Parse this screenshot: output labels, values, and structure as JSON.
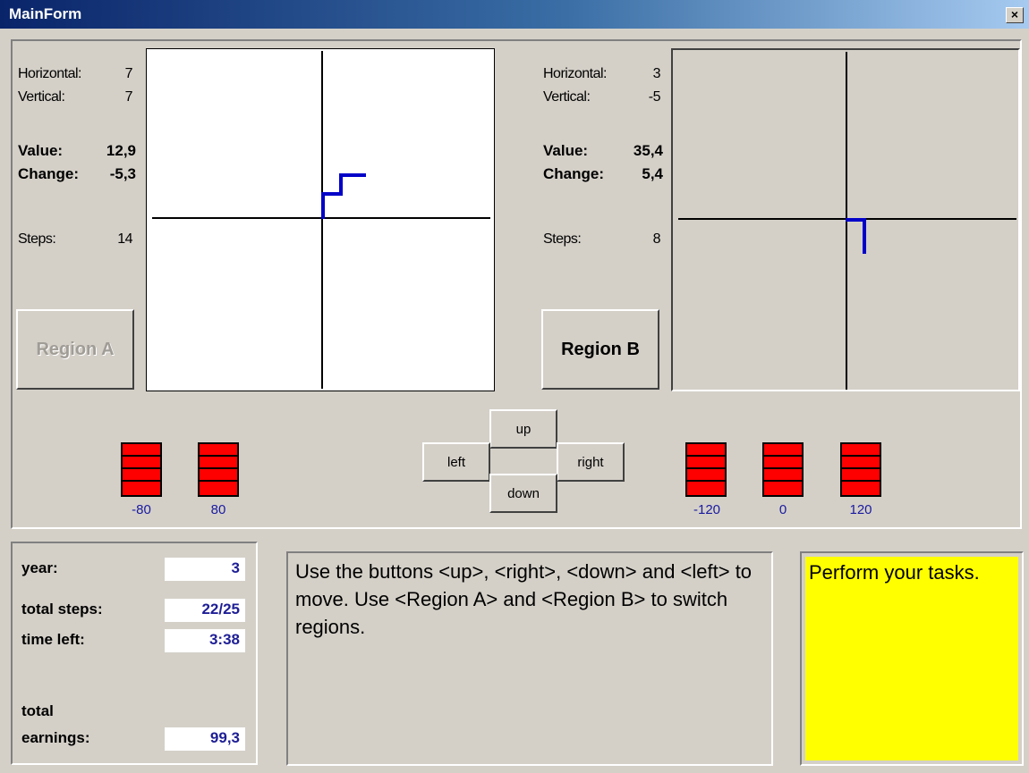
{
  "window": {
    "title": "MainForm",
    "close_glyph": "×"
  },
  "region_a": {
    "horizontal_label": "Horizontal:",
    "horizontal": "7",
    "vertical_label": "Vertical:",
    "vertical": "7",
    "value_label": "Value:",
    "value": "12,9",
    "change_label": "Change:",
    "change": "-5,3",
    "steps_label": "Steps:",
    "steps": "14",
    "button_label": "Region A",
    "button_enabled": false
  },
  "region_b": {
    "horizontal_label": "Horizontal:",
    "horizontal": "3",
    "vertical_label": "Vertical:",
    "vertical": "-5",
    "value_label": "Value:",
    "value": "35,4",
    "change_label": "Change:",
    "change": "5,4",
    "steps_label": "Steps:",
    "steps": "8",
    "button_label": "Region B",
    "button_enabled": true
  },
  "controls": {
    "up": "up",
    "down": "down",
    "left": "left",
    "right": "right"
  },
  "indicators_a": [
    "-80",
    "80"
  ],
  "indicators_b": [
    "-120",
    "0",
    "120"
  ],
  "status": {
    "year_label": "year:",
    "year": "3",
    "steps_label": "total steps:",
    "steps": "22/25",
    "time_label": "time left:",
    "time": "3:38",
    "earnings_label_1": "total",
    "earnings_label_2": "earnings:",
    "earnings": "99,3"
  },
  "instructions": "Use the buttons <up>, <right>, <down> and <left> to move. Use <Region A> and <Region B> to switch regions.",
  "task_message": "Perform your tasks.",
  "colors": {
    "path": "#0000c8",
    "indicator": "#ff0000",
    "task_bg": "#ffff00",
    "title_bar": "#0a246a"
  }
}
